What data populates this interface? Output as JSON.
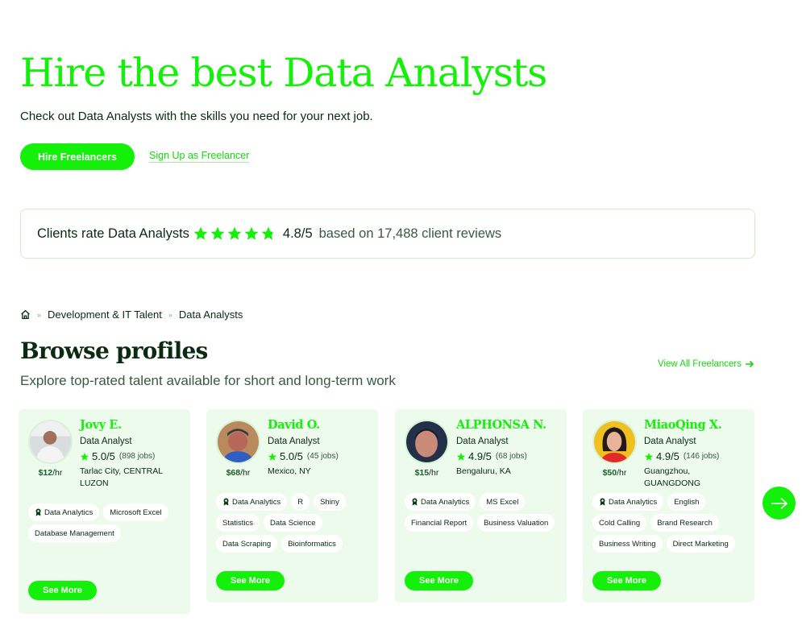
{
  "hero": {
    "title": "Hire the best Data Analysts",
    "subtitle": "Check out Data Analysts with the skills you need for your next job.",
    "hire_button": "Hire Freelancers",
    "signup_link": "Sign Up as Freelancer"
  },
  "rating": {
    "label": "Clients rate Data Analysts",
    "stars_value": 4.8,
    "stars_max": 5,
    "score": "4.8/5",
    "reviews": "based on 17,488 client reviews"
  },
  "breadcrumb": {
    "home_icon": "home-icon",
    "items": [
      "Development & IT Talent",
      "Data Analysts"
    ],
    "separator": "»"
  },
  "browse": {
    "title": "Browse profiles",
    "subtitle": "Explore top-rated talent available for short and long-term work",
    "view_all": "View All Freelancers"
  },
  "profiles": [
    {
      "name": "Jovy E.",
      "role": "Data Analyst",
      "score": "5.0/5",
      "jobs": "(898 jobs)",
      "location": "Tarlac City, CENTRAL LUZON",
      "rate_amount": "$12",
      "rate_unit": "/hr",
      "skills": [
        "Data Analytics",
        "Microsoft Excel",
        "Database Management"
      ],
      "see_more": "See More"
    },
    {
      "name": "David O.",
      "role": "Data Analyst",
      "score": "5.0/5",
      "jobs": "(45 jobs)",
      "location": "Mexico, NY",
      "rate_amount": "$68",
      "rate_unit": "/hr",
      "skills": [
        "Data Analytics",
        "R",
        "Shiny",
        "Statistics",
        "Data Science",
        "Data Scraping",
        "Bioinformatics"
      ],
      "see_more": "See More"
    },
    {
      "name": "ALPHONSA N.",
      "role": "Data Analyst",
      "score": "4.9/5",
      "jobs": "(68 jobs)",
      "location": "Bengaluru, KA",
      "rate_amount": "$15",
      "rate_unit": "/hr",
      "skills": [
        "Data Analytics",
        "MS Excel",
        "Financial Report",
        "Business Valuation"
      ],
      "see_more": "See More"
    },
    {
      "name": "MiaoQing X.",
      "role": "Data Analyst",
      "score": "4.9/5",
      "jobs": "(146 jobs)",
      "location": "Guangzhou, GUANGDONG",
      "rate_amount": "$50",
      "rate_unit": "/hr",
      "skills": [
        "Data Analytics",
        "English",
        "Cold Calling",
        "Brand Research",
        "Business Writing",
        "Direct Marketing"
      ],
      "see_more": "See More"
    }
  ],
  "carousel": {
    "next_icon": "arrow-right-icon"
  },
  "colors": {
    "accent": "#14f00a",
    "text_dark": "#0b2a12",
    "text_muted": "#3a5a40",
    "card_bg": "#ecfbec",
    "border": "#cfeccc"
  }
}
